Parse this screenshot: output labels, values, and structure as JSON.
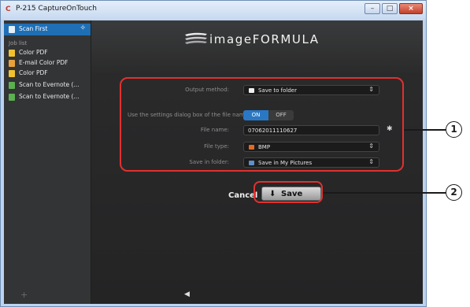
{
  "window": {
    "title": "P-215 CaptureOnTouch",
    "controls": [
      "–",
      "□",
      "×"
    ]
  },
  "sidebar": {
    "scan_first": "Scan First",
    "job_list_label": "Job list",
    "jobs": [
      {
        "label": "Color PDF",
        "icon_color": "#f2c12e"
      },
      {
        "label": "E-mail Color PDF",
        "icon_color": "#e8a23a"
      },
      {
        "label": "Color PDF",
        "icon_color": "#f2c12e"
      },
      {
        "label": "Scan to Evernote (...",
        "icon_color": "#5bb04f"
      },
      {
        "label": "Scan to Evernote (...",
        "icon_color": "#5bb04f"
      }
    ],
    "add_label": "+"
  },
  "header": {
    "logo_text": "imageFORMULA"
  },
  "form": {
    "output_method": {
      "label": "Output method:",
      "value": "Save to folder"
    },
    "settings_dialog": {
      "label": "Use the settings dialog box of the file name",
      "on": "ON",
      "off": "OFF",
      "selected": "ON"
    },
    "file_name": {
      "label": "File name:",
      "value": "07062011110627"
    },
    "file_type": {
      "label": "File type:",
      "value": "BMP"
    },
    "save_in_folder": {
      "label": "Save in folder:",
      "value": "Save in My Pictures"
    }
  },
  "actions": {
    "cancel": "Cancel",
    "save": "Save"
  },
  "callouts": [
    "1",
    "2"
  ],
  "colors": {
    "accent": "#1f6fb5",
    "toggle_on": "#2a78c4",
    "callout": "#e0312f"
  },
  "icons": {
    "back": "back-arrow-icon",
    "settings": "gear-icon"
  }
}
